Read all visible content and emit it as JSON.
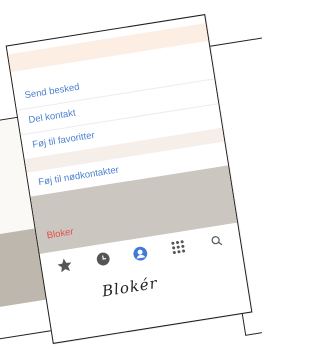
{
  "menu": {
    "group1": [
      "Send besked",
      "Del kontakt",
      "Føj til favoritter"
    ],
    "group2": [
      "Føj til nødkontakter"
    ],
    "block_label": "Bloker"
  },
  "tabbar": {
    "icons": [
      "star-icon",
      "clock-icon",
      "person-icon",
      "grid-icon",
      "search-icon"
    ],
    "active": "person-icon",
    "active_color": "#3f7ad6",
    "inactive_color": "#555555"
  },
  "caption": "Blokér",
  "colors": {
    "link": "#4a7fcf",
    "danger": "#e2504a",
    "highlight": "#cbc6bf"
  }
}
